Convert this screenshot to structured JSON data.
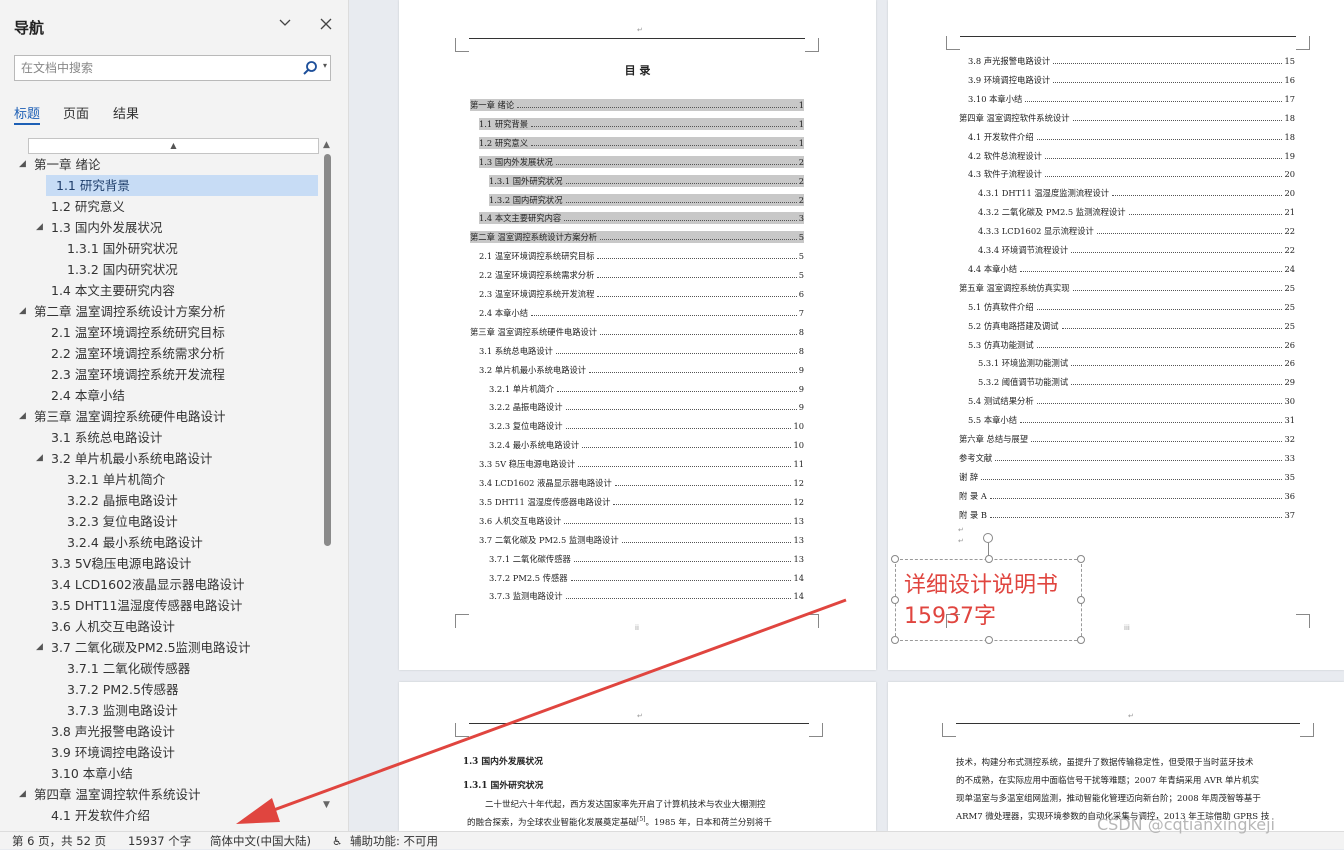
{
  "nav": {
    "title": "导航",
    "search_placeholder": "在文档中搜索",
    "tabs": [
      {
        "label": "标题"
      },
      {
        "label": "页面"
      },
      {
        "label": "结果"
      }
    ],
    "tree": [
      {
        "label": "第一章  绪论",
        "level": 0,
        "expand": true
      },
      {
        "label": "1.1 研究背景",
        "level": 1,
        "selected": true
      },
      {
        "label": "1.2 研究意义",
        "level": 1
      },
      {
        "label": "1.3 国内外发展状况",
        "level": 1,
        "expand": true
      },
      {
        "label": "1.3.1 国外研究状况",
        "level": 2
      },
      {
        "label": "1.3.2 国内研究状况",
        "level": 2
      },
      {
        "label": "1.4 本文主要研究内容",
        "level": 1
      },
      {
        "label": "第二章  温室调控系统设计方案分析",
        "level": 0,
        "expand": true
      },
      {
        "label": "2.1 温室环境调控系统研究目标",
        "level": 1
      },
      {
        "label": "2.2 温室环境调控系统需求分析",
        "level": 1
      },
      {
        "label": "2.3 温室环境调控系统开发流程",
        "level": 1
      },
      {
        "label": "2.4 本章小结",
        "level": 1
      },
      {
        "label": "第三章  温室调控系统硬件电路设计",
        "level": 0,
        "expand": true
      },
      {
        "label": "3.1 系统总电路设计",
        "level": 1
      },
      {
        "label": "3.2 单片机最小系统电路设计",
        "level": 1,
        "expand": true
      },
      {
        "label": "3.2.1 单片机简介",
        "level": 2
      },
      {
        "label": "3.2.2 晶振电路设计",
        "level": 2
      },
      {
        "label": "3.2.3 复位电路设计",
        "level": 2
      },
      {
        "label": "3.2.4 最小系统电路设计",
        "level": 2
      },
      {
        "label": "3.3 5V稳压电源电路设计",
        "level": 1
      },
      {
        "label": "3.4 LCD1602液晶显示器电路设计",
        "level": 1
      },
      {
        "label": "3.5 DHT11温湿度传感器电路设计",
        "level": 1
      },
      {
        "label": "3.6 人机交互电路设计",
        "level": 1
      },
      {
        "label": "3.7 二氧化碳及PM2.5监测电路设计",
        "level": 1,
        "expand": true
      },
      {
        "label": "3.7.1 二氧化碳传感器",
        "level": 2
      },
      {
        "label": "3.7.2 PM2.5传感器",
        "level": 2
      },
      {
        "label": "3.7.3 监测电路设计",
        "level": 2
      },
      {
        "label": "3.8 声光报警电路设计",
        "level": 1
      },
      {
        "label": "3.9 环境调控电路设计",
        "level": 1
      },
      {
        "label": "3.10 本章小结",
        "level": 1
      },
      {
        "label": "第四章  温室调控软件系统设计",
        "level": 0,
        "expand": true
      },
      {
        "label": "4.1 开发软件介绍",
        "level": 1
      }
    ]
  },
  "page1": {
    "title": "目  录",
    "toc": [
      {
        "label": "第一章   绪论",
        "page": "1",
        "level": 0,
        "hl": true
      },
      {
        "label": "1.1  研究背景",
        "page": "1",
        "level": 1,
        "hl": true
      },
      {
        "label": "1.2  研究意义",
        "page": "1",
        "level": 1,
        "hl": true
      },
      {
        "label": "1.3  国内外发展状况",
        "page": "2",
        "level": 1,
        "hl": true
      },
      {
        "label": "1.3.1  国外研究状况",
        "page": "2",
        "level": 2,
        "hl": true
      },
      {
        "label": "1.3.2  国内研究状况",
        "page": "2",
        "level": 2,
        "hl": true
      },
      {
        "label": "1.4  本文主要研究内容",
        "page": "3",
        "level": 1,
        "hl": true
      },
      {
        "label": "第二章   温室调控系统设计方案分析",
        "page": "5",
        "level": 0,
        "hl": true
      },
      {
        "label": "2.1  温室环境调控系统研究目标",
        "page": "5",
        "level": 1
      },
      {
        "label": "2.2  温室环境调控系统需求分析",
        "page": "5",
        "level": 1
      },
      {
        "label": "2.3  温室环境调控系统开发流程",
        "page": "6",
        "level": 1
      },
      {
        "label": "2.4  本章小结",
        "page": "7",
        "level": 1
      },
      {
        "label": "第三章   温室调控系统硬件电路设计",
        "page": "8",
        "level": 0
      },
      {
        "label": "3.1  系统总电路设计",
        "page": "8",
        "level": 1
      },
      {
        "label": "3.2  单片机最小系统电路设计",
        "page": "9",
        "level": 1
      },
      {
        "label": "3.2.1  单片机简介",
        "page": "9",
        "level": 2
      },
      {
        "label": "3.2.2  晶振电路设计",
        "page": "9",
        "level": 2
      },
      {
        "label": "3.2.3  复位电路设计",
        "page": "10",
        "level": 2
      },
      {
        "label": "3.2.4  最小系统电路设计",
        "page": "10",
        "level": 2
      },
      {
        "label": "3.3 5V 稳压电源电路设计",
        "page": "11",
        "level": 1
      },
      {
        "label": "3.4 LCD1602 液晶显示器电路设计",
        "page": "12",
        "level": 1
      },
      {
        "label": "3.5 DHT11 温湿度传感器电路设计",
        "page": "12",
        "level": 1
      },
      {
        "label": "3.6  人机交互电路设计",
        "page": "13",
        "level": 1
      },
      {
        "label": "3.7  二氧化碳及 PM2.5 监测电路设计",
        "page": "13",
        "level": 1
      },
      {
        "label": "3.7.1  二氧化碳传感器",
        "page": "13",
        "level": 2
      },
      {
        "label": "3.7.2 PM2.5 传感器",
        "page": "14",
        "level": 2
      },
      {
        "label": "3.7.3  监测电路设计",
        "page": "14",
        "level": 2
      }
    ]
  },
  "page2": {
    "toc": [
      {
        "label": "3.8  声光报警电路设计",
        "page": "15",
        "level": 1
      },
      {
        "label": "3.9  环境调控电路设计",
        "page": "16",
        "level": 1
      },
      {
        "label": "3.10  本章小结",
        "page": "17",
        "level": 1
      },
      {
        "label": "第四章   温室调控软件系统设计",
        "page": "18",
        "level": 0
      },
      {
        "label": "4.1  开发软件介绍",
        "page": "18",
        "level": 1
      },
      {
        "label": "4.2  软件总流程设计",
        "page": "19",
        "level": 1
      },
      {
        "label": "4.3  软件子流程设计",
        "page": "20",
        "level": 1
      },
      {
        "label": "4.3.1 DHT11 温湿度监测流程设计",
        "page": "20",
        "level": 2
      },
      {
        "label": "4.3.2  二氧化碳及 PM2.5 监测流程设计",
        "page": "21",
        "level": 2
      },
      {
        "label": "4.3.3 LCD1602 显示流程设计",
        "page": "22",
        "level": 2
      },
      {
        "label": "4.3.4  环境调节流程设计",
        "page": "22",
        "level": 2
      },
      {
        "label": "4.4  本章小结",
        "page": "24",
        "level": 1
      },
      {
        "label": "第五章   温室调控系统仿真实现",
        "page": "25",
        "level": 0
      },
      {
        "label": "5.1  仿真软件介绍",
        "page": "25",
        "level": 1
      },
      {
        "label": "5.2  仿真电路搭建及调试",
        "page": "25",
        "level": 1
      },
      {
        "label": "5.3  仿真功能测试",
        "page": "26",
        "level": 1
      },
      {
        "label": "5.3.1  环境监测功能测试",
        "page": "26",
        "level": 2
      },
      {
        "label": "5.3.2  阈值调节功能测试",
        "page": "29",
        "level": 2
      },
      {
        "label": "5.4  测试结果分析",
        "page": "30",
        "level": 1
      },
      {
        "label": "5.5  本章小结",
        "page": "31",
        "level": 1
      },
      {
        "label": "第六章   总结与展望",
        "page": "32",
        "level": 0
      },
      {
        "label": "参考文献",
        "page": "33",
        "level": 0
      },
      {
        "label": "谢  辞",
        "page": "35",
        "level": 0
      },
      {
        "label": "附  录 A",
        "page": "36",
        "level": 0
      },
      {
        "label": "附  录 B",
        "page": "37",
        "level": 0
      }
    ]
  },
  "page3": {
    "h1": "1.3  国内外发展状况",
    "h2": "1.3.1  国外研究状况",
    "l1": "二十世纪六十年代起，西方发达国家率先开启了计算机技术与农业大棚测控",
    "l2": "的融合探索，为全球农业智能化发展奠定基础",
    "l2b": "[5]",
    "l2c": "。1985 年，日本和荷兰分别将千"
  },
  "page4": {
    "lines": [
      "技术，构建分布式测控系统，虽提升了数据传输稳定性，但受限于当时蓝牙技术",
      "的不成熟，在实际应用中面临信号干扰等难题；2007 年青绢采用 AVR 单片机实",
      "现单温室与多温室组网监测，推动智能化管理迈向新台阶；2008 年周茂智等基于",
      "ARM7 微处理器，实现环境参数的自动化采集与调控，2013 年王琮借助 GPRS 技"
    ]
  },
  "annotation": {
    "line1": "详细设计说明书",
    "line2": "15937字"
  },
  "status": {
    "page": "第 6 页，共 52 页",
    "words": "15937 个字",
    "lang": "简体中文(中国大陆)",
    "access": "辅助功能: 不可用"
  },
  "watermark": "CSDN @cqtianxingkeji",
  "colors": {
    "accent": "#1d5fb5",
    "selection": "#c7dcf5",
    "annotation": "#e0453f",
    "arrow": "#e0453f"
  }
}
